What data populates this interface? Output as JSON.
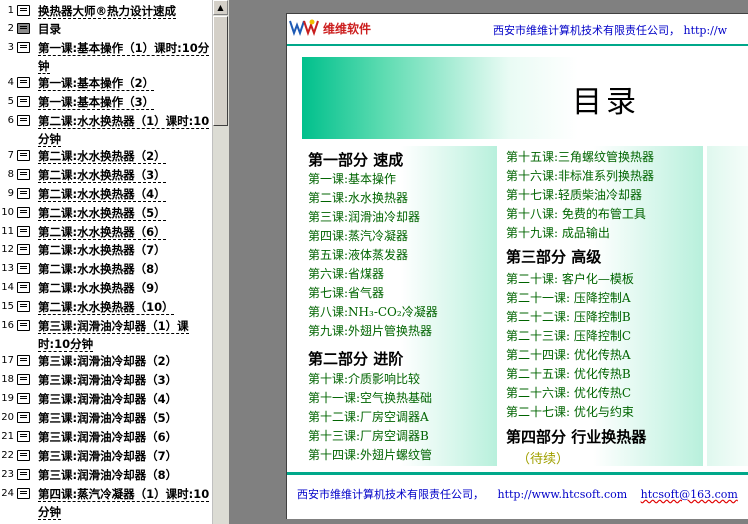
{
  "outline": [
    {
      "num": "1",
      "text": "换热器大师®热力设计速成",
      "selected": false,
      "underline": true
    },
    {
      "num": "2",
      "text": "目录",
      "selected": true,
      "underline": false
    },
    {
      "num": "3",
      "text": "第一课:基本操作（1）课时:10分钟",
      "selected": false,
      "underline": true
    },
    {
      "num": "4",
      "text": "第一课:基本操作（2）",
      "selected": false,
      "underline": true
    },
    {
      "num": "5",
      "text": "第一课:基本操作（3）",
      "selected": false,
      "underline": true
    },
    {
      "num": "6",
      "text": "第二课:水水换热器（1）课时:10分钟",
      "selected": false,
      "underline": true
    },
    {
      "num": "7",
      "text": "第二课:水水换热器（2）",
      "selected": false,
      "underline": true
    },
    {
      "num": "8",
      "text": "第二课:水水换热器（3）",
      "selected": false,
      "underline": true
    },
    {
      "num": "9",
      "text": "第二课:水水换热器（4）",
      "selected": false,
      "underline": true
    },
    {
      "num": "10",
      "text": "第二课:水水换热器（5）",
      "selected": false,
      "underline": true
    },
    {
      "num": "11",
      "text": "第二课:水水换热器（6）",
      "selected": false,
      "underline": true
    },
    {
      "num": "12",
      "text": "第二课:水水换热器（7）",
      "selected": false,
      "underline": false
    },
    {
      "num": "13",
      "text": "第二课:水水换热器（8）",
      "selected": false,
      "underline": false
    },
    {
      "num": "14",
      "text": "第二课:水水换热器（9）",
      "selected": false,
      "underline": false
    },
    {
      "num": "15",
      "text": "第二课:水水换热器（10）",
      "selected": false,
      "underline": true
    },
    {
      "num": "16",
      "text": "第三课:润滑油冷却器（1）课时:10分钟",
      "selected": false,
      "underline": true
    },
    {
      "num": "17",
      "text": "第三课:润滑油冷却器（2）",
      "selected": false,
      "underline": false
    },
    {
      "num": "18",
      "text": "第三课:润滑油冷却器（3）",
      "selected": false,
      "underline": false
    },
    {
      "num": "19",
      "text": "第三课:润滑油冷却器（4）",
      "selected": false,
      "underline": false
    },
    {
      "num": "20",
      "text": "第三课:润滑油冷却器（5）",
      "selected": false,
      "underline": false
    },
    {
      "num": "21",
      "text": "第三课:润滑油冷却器（6）",
      "selected": false,
      "underline": false
    },
    {
      "num": "22",
      "text": "第三课:润滑油冷却器（7）",
      "selected": false,
      "underline": false
    },
    {
      "num": "23",
      "text": "第三课:润滑油冷却器（8）",
      "selected": false,
      "underline": false
    },
    {
      "num": "24",
      "text": "第四课:蒸汽冷凝器（1）课时:10分钟",
      "selected": false,
      "underline": true
    }
  ],
  "slide": {
    "logo_text": "维维软件",
    "company_top": "西安市维维计算机技术有限责任公司， http://w",
    "title": "目录",
    "col1": {
      "part1_title": "第一部分  速成",
      "part1_lessons": [
        "第一课:基本操作",
        "第二课:水水换热器",
        "第三课:润滑油冷却器",
        "第四课:蒸汽冷凝器",
        "第五课:液体蒸发器",
        "第六课:省煤器",
        "第七课:省气器",
        "第八课:NH₃-CO₂冷凝器",
        "第九课:外翅片管换热器"
      ],
      "part2_title": "第二部分  进阶",
      "part2_lessons": [
        "第十课:介质影响比较",
        "第十一课:空气换热基础",
        "第十二课:厂房空调器A",
        "第十三课:厂房空调器B",
        "第十四课:外翅片螺纹管"
      ]
    },
    "col2": {
      "part2_more": [
        "第十五课:三角螺纹管换热器",
        "第十六课:非标准系列换热器",
        "第十七课:轻质柴油冷却器",
        "第十八课: 免费的布管工具",
        "第十九课: 成品输出"
      ],
      "part3_title": "第三部分  高级",
      "part3_lessons": [
        "第二十课: 客户化—模板",
        "第二十一课: 压降控制A",
        "第二十二课: 压降控制B",
        "第二十三课: 压降控制C",
        "第二十四课: 优化传热A",
        "第二十五课: 优化传热B",
        "第二十六课: 优化传热C",
        "第二十七课: 优化与约束"
      ],
      "part4_title": "第四部分  行业换热器",
      "continued": "（待续）"
    },
    "footer": {
      "company": "西安市维维计算机技术有限责任公司，",
      "url": "http://www.htcsoft.com",
      "email": "htcsoft@163.com"
    }
  },
  "colors": {
    "accent": "#00a88a",
    "lesson_text": "#006400",
    "link_text": "#0000c8",
    "logo_text": "#cc1e1e",
    "continued": "#a0a000"
  }
}
